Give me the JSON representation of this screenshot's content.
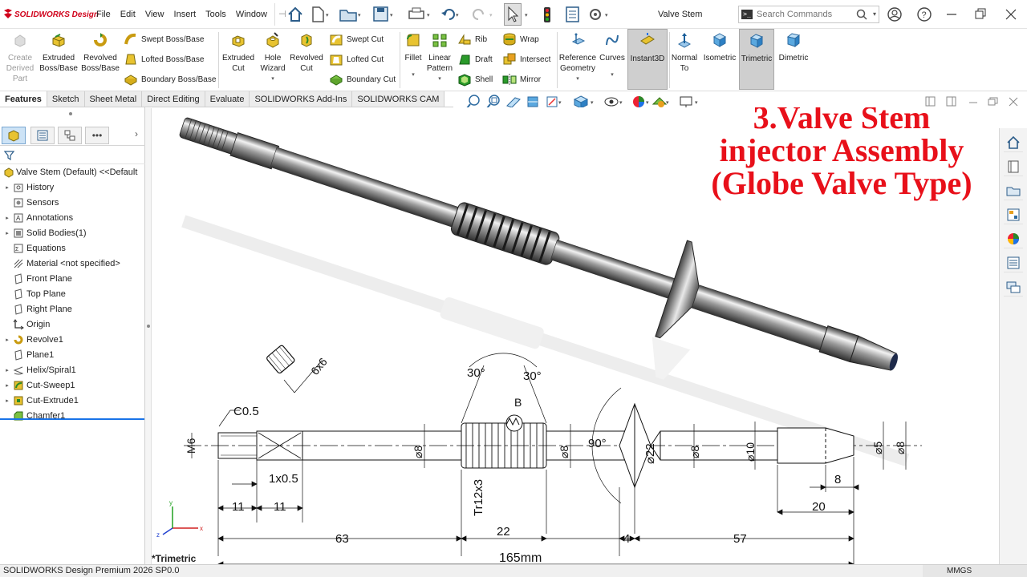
{
  "app": {
    "logo_text": "SOLIDWORKS Design",
    "document_title": "Valve Stem"
  },
  "menu": [
    "File",
    "Edit",
    "View",
    "Insert",
    "Tools",
    "Window"
  ],
  "search": {
    "placeholder": "Search Commands"
  },
  "command_manager": {
    "create_derived": "Create Derived Part",
    "extruded_boss": "Extruded Boss/Base",
    "revolved_boss": "Revolved Boss/Base",
    "swept_boss": "Swept Boss/Base",
    "lofted_boss": "Lofted Boss/Base",
    "boundary_boss": "Boundary Boss/Base",
    "extruded_cut": "Extruded Cut",
    "hole_wizard": "Hole Wizard",
    "revolved_cut": "Revolved Cut",
    "swept_cut": "Swept Cut",
    "lofted_cut": "Lofted Cut",
    "boundary_cut": "Boundary Cut",
    "fillet": "Fillet",
    "linear_pattern": "Linear Pattern",
    "rib": "Rib",
    "draft": "Draft",
    "shell": "Shell",
    "wrap": "Wrap",
    "intersect": "Intersect",
    "mirror": "Mirror",
    "reference_geometry": "Reference Geometry",
    "curves": "Curves",
    "instant3d": "Instant3D",
    "normal_to": "Normal To",
    "isometric": "Isometric",
    "trimetric": "Trimetric",
    "dimetric": "Dimetric"
  },
  "tabs": [
    "Features",
    "Sketch",
    "Sheet Metal",
    "Direct Editing",
    "Evaluate",
    "SOLIDWORKS Add-Ins",
    "SOLIDWORKS CAM"
  ],
  "feature_tree": {
    "root": "Valve Stem (Default) <<Default",
    "items": [
      "History",
      "Sensors",
      "Annotations",
      "Solid Bodies(1)",
      "Equations",
      "Material <not specified>",
      "Front Plane",
      "Top Plane",
      "Right Plane",
      "Origin",
      "Revolve1",
      "Plane1",
      "Helix/Spiral1",
      "Cut-Sweep1",
      "Cut-Extrude1",
      "Chamfer1"
    ]
  },
  "overlay_title": [
    "3.Valve Stem",
    "injector Assembly",
    "(Globe Valve Type)"
  ],
  "drawing": {
    "thread_label": "M6",
    "chamfer_label": "C0.5",
    "flat_label": "6x6",
    "undercut_label": "1x0.5",
    "dim_11a": "11",
    "dim_11b": "11",
    "dim_63": "63",
    "dim_22": "22",
    "dim_4": "4",
    "dim_57": "57",
    "dim_20": "20",
    "dim_8": "8",
    "dim_total": "165mm",
    "angle_30a": "30°",
    "angle_30b": "30°",
    "detail_b": "B",
    "acme_label": "Tr12x3",
    "dia_8a": "⌀8",
    "dia_8b": "⌀8",
    "angle_90": "90°",
    "dia_22": "⌀22",
    "dia_8c": "⌀8",
    "dia_10": "⌀10",
    "dia_5": "⌀5",
    "dia_8d": "⌀8"
  },
  "view_name": "*Trimetric",
  "status": {
    "text": "SOLIDWORKS Design Premium 2026 SP0.0",
    "units": "MMGS"
  },
  "colors": {
    "accent_red": "#d0021b",
    "title_red": "#e8101a",
    "rollback_blue": "#1a73e8"
  }
}
